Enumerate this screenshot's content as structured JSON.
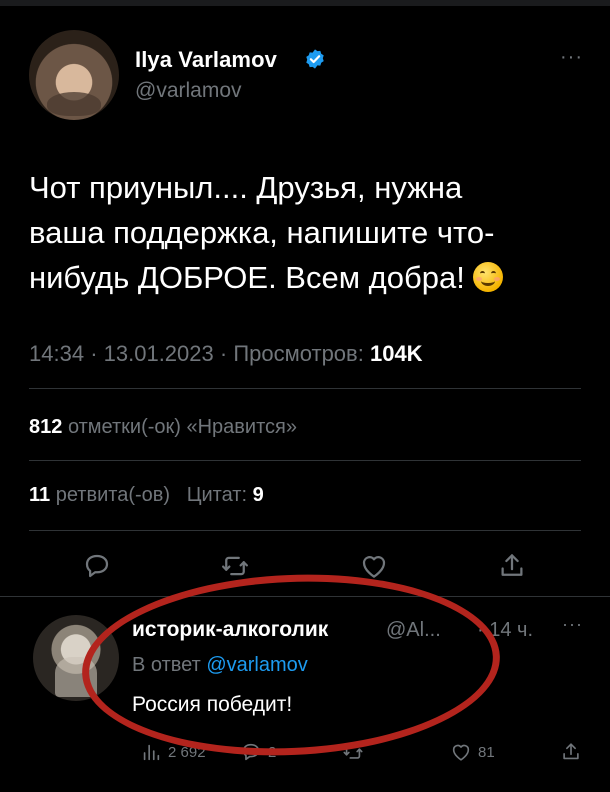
{
  "tweet": {
    "author": {
      "name": "Ilya Varlamov",
      "handle": "@varlamov",
      "verified_icon": "verified-badge-icon",
      "avatar": "author-avatar"
    },
    "more_label": "···",
    "text_line1": "Чот приуныл.... Друзья, нужна",
    "text_line2": "ваша поддержка, напишите что-",
    "text_line3": "нибудь ДОБРОЕ. Всем добра!",
    "emoji": "smiling-face-icon",
    "time": "14:34",
    "date": "13.01.2023",
    "separator": "·",
    "views_label": "Просмотров:",
    "views_count": "104K",
    "likes_count": "812",
    "likes_label": "отметки(-ок) «Нравится»",
    "retweets_count": "11",
    "retweets_label": "ретвита(-ов)",
    "quotes_label": "Цитат:",
    "quotes_count": "9",
    "actions": [
      "reply-icon",
      "retweet-icon",
      "like-icon",
      "share-icon"
    ]
  },
  "reply": {
    "name": "историк-алкоголик",
    "handle": "@Al...",
    "separator": "·",
    "time": "14 ч.",
    "more_label": "···",
    "reply_to_label": "В ответ",
    "reply_to_handle": "@varlamov",
    "text": "Россия победит!",
    "views": "2 692",
    "replies": "2",
    "retweets": "",
    "likes": "81"
  },
  "annotation": {
    "color": "#b3241d"
  },
  "colors": {
    "background": "#000000",
    "text": "#e7e9ea",
    "muted": "#71767b",
    "link": "#1d9bf0",
    "divider": "#2f3336"
  }
}
